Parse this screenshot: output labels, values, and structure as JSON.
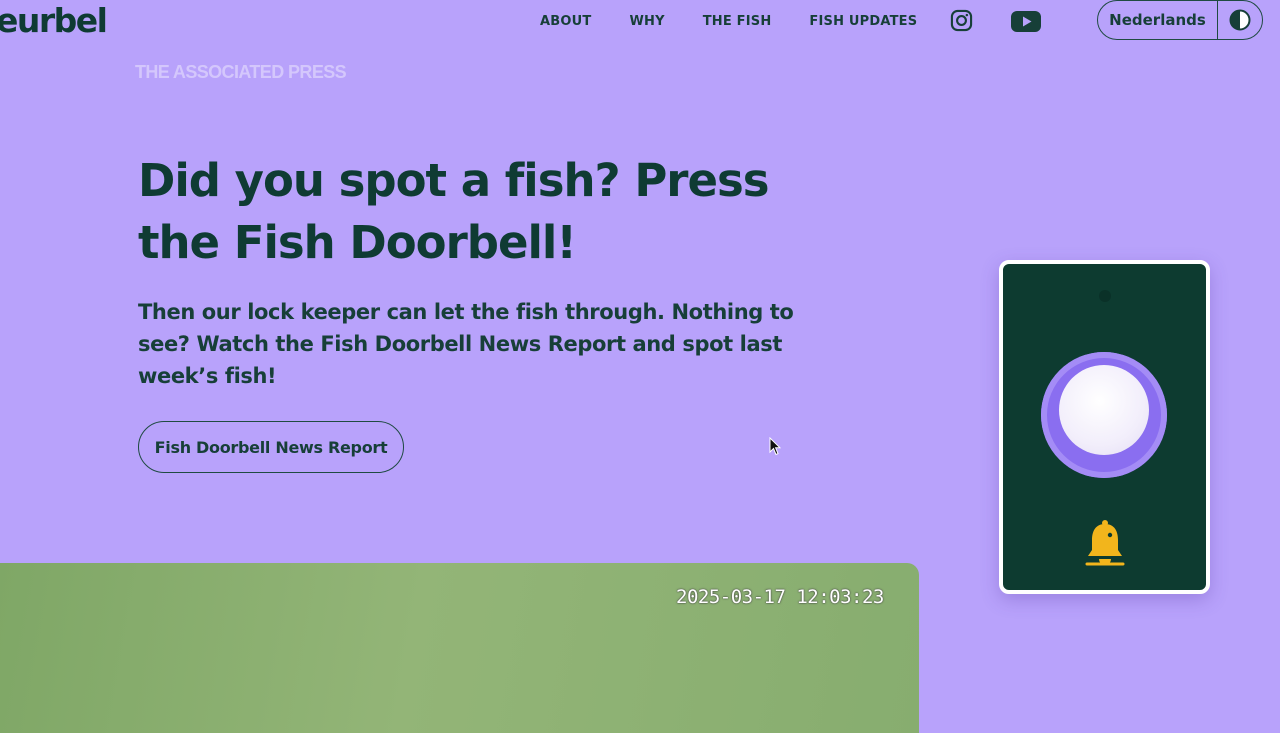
{
  "header": {
    "logo_text": "eurbel",
    "nav": [
      "ABOUT",
      "WHY",
      "THE FISH",
      "FISH UPDATES"
    ],
    "social_icons": [
      "instagram-icon",
      "youtube-icon"
    ],
    "language_button": "Nederlands",
    "contrast_icon": "contrast-icon"
  },
  "watermark": "THE ASSOCIATED PRESS",
  "hero": {
    "headline": "Did you spot a fish? Press the Fish Doorbell!",
    "subtext": "Then our lock keeper can let the fish through. Nothing to see? Watch the Fish Doorbell News Report and spot last week’s fish!",
    "button_label": "Fish Doorbell News Report"
  },
  "video": {
    "timestamp": "2025-03-17 12:03:23"
  },
  "doorbell": {
    "icon": "bell-icon",
    "colors": {
      "panel": "#0d3b30",
      "button_ring": "#8a6ef0",
      "bell": "#f2b51c"
    }
  },
  "colors": {
    "background": "#b8a2fb",
    "text": "#0f3b33"
  }
}
